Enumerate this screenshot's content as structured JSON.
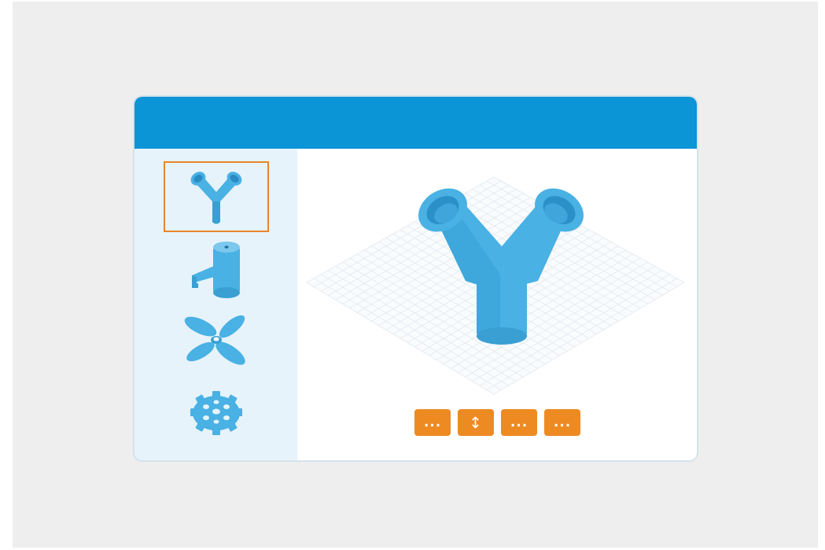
{
  "colors": {
    "titlebar": "#0b94d6",
    "sidebar": "#e6f3fb",
    "accent": "#ee8a22",
    "selection": "#e8862c",
    "model": "#49b1e3"
  },
  "sidebar": {
    "items": [
      {
        "icon": "y-pipe-icon",
        "selected": true
      },
      {
        "icon": "faucet-icon",
        "selected": false
      },
      {
        "icon": "propeller-icon",
        "selected": false
      },
      {
        "icon": "gear-icon",
        "selected": false
      }
    ]
  },
  "viewport": {
    "model": "y-pipe",
    "grid": true
  },
  "toolbar": {
    "buttons": [
      {
        "icon": "more-icon",
        "label": "..."
      },
      {
        "icon": "vertical-arrows-icon",
        "label": "↕"
      },
      {
        "icon": "more-icon",
        "label": "..."
      },
      {
        "icon": "more-icon",
        "label": "..."
      }
    ]
  }
}
